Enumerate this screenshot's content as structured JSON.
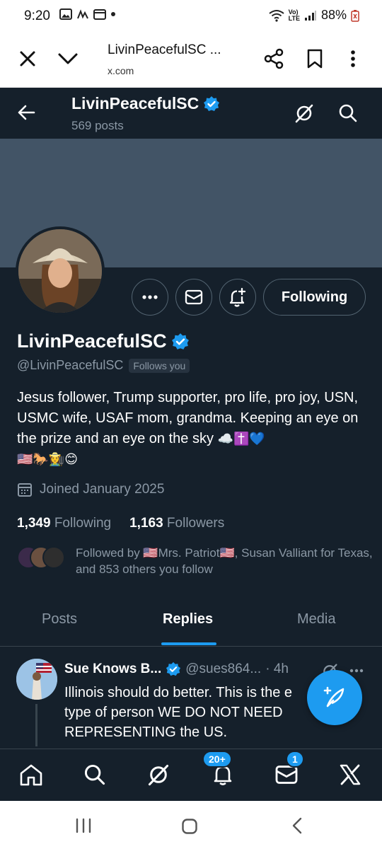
{
  "status_bar": {
    "time": "9:20",
    "battery": "88%"
  },
  "browser": {
    "title": "LivinPeacefulSC ...",
    "url": "x.com"
  },
  "profile_header": {
    "name": "LivinPeacefulSC",
    "posts": "569 posts"
  },
  "actions": {
    "following_label": "Following"
  },
  "profile": {
    "display_name": "LivinPeacefulSC",
    "handle": "@LivinPeacefulSC",
    "follows_you": "Follows you",
    "bio_line1": "Jesus follower, Trump supporter, pro life, pro joy, USN, USMC wife, USAF mom,  grandma. Keeping an eye on the prize and an eye on the sky",
    "bio_emojis_1": "☁️✝️💙",
    "bio_emojis_2": "🇺🇸🐎👩‍🌾😊",
    "joined": "Joined January 2025",
    "following_count": "1,349",
    "following_label": "Following",
    "followers_count": "1,163",
    "followers_label": "Followers",
    "followed_by": "Followed by 🇺🇸Mrs. Patriot🇺🇸, Susan Valliant for Texas, and 853 others you follow"
  },
  "tabs": [
    {
      "label": "Posts",
      "active": false
    },
    {
      "label": "Replies",
      "active": true
    },
    {
      "label": "Media",
      "active": false
    }
  ],
  "tweet": {
    "author": "Sue Knows B...",
    "handle": "@sues864...",
    "time": "· 4h",
    "text": "Illinois should do better. This is the e type of person WE DO NOT NEED REPRESENTING the US."
  },
  "bottom_nav": {
    "notifications_badge": "20+",
    "messages_badge": "1"
  },
  "colors": {
    "background": "#15202b",
    "accent": "#1d9bf0",
    "banner": "#425466",
    "muted": "#8b98a5"
  },
  "icons": [
    "back-arrow-icon",
    "grok-icon",
    "search-icon",
    "more-icon",
    "mail-icon",
    "bell-plus-icon",
    "verified-badge-icon",
    "calendar-icon",
    "compose-icon",
    "home-icon",
    "bell-icon",
    "x-logo-icon",
    "share-icon",
    "bookmark-icon",
    "close-icon",
    "chevron-down-icon"
  ]
}
